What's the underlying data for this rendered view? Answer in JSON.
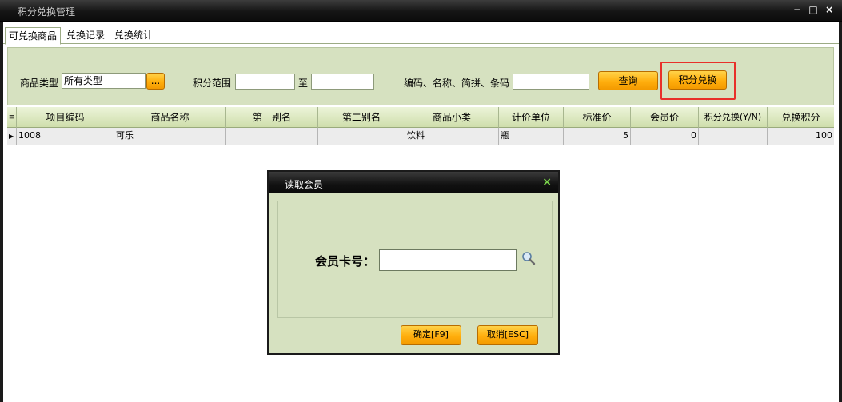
{
  "window": {
    "title": "积分兑换管理",
    "minimize": "−",
    "maximize": "□",
    "close": "×"
  },
  "tabs": [
    {
      "label": "可兑换商品",
      "active": true
    },
    {
      "label": "兑换记录",
      "active": false
    },
    {
      "label": "兑换统计",
      "active": false
    }
  ],
  "filters": {
    "type_label": "商品类型",
    "type_value": "所有类型",
    "type_picker": "...",
    "points_label": "积分范围",
    "points_from": "",
    "points_to_label": "至",
    "points_to": "",
    "keyword_label": "编码、名称、简拼、条码",
    "keyword_value": "",
    "query_button": "查询",
    "exchange_button": "积分兑换"
  },
  "grid": {
    "headers": [
      "项目编码",
      "商品名称",
      "第一别名",
      "第二别名",
      "商品小类",
      "计价单位",
      "标准价",
      "会员价",
      "积分兑换(Y/N)",
      "兑换积分"
    ],
    "rows": [
      {
        "code": "1008",
        "name": "可乐",
        "alias1": "",
        "alias2": "",
        "subcategory": "饮料",
        "unit": "瓶",
        "std_price": "5",
        "member_price": "0",
        "exchangeable": "",
        "points": "100"
      }
    ]
  },
  "dialog": {
    "title": "读取会员",
    "close": "×",
    "card_label": "会员卡号：",
    "card_value": "",
    "ok_button": "确定[F9]",
    "cancel_button": "取消[ESC]"
  },
  "colors": {
    "accent_orange": "#ffae0d",
    "panel_green": "#d6e1c0",
    "highlight": "#e8302a",
    "close_green": "#7ad34a"
  }
}
